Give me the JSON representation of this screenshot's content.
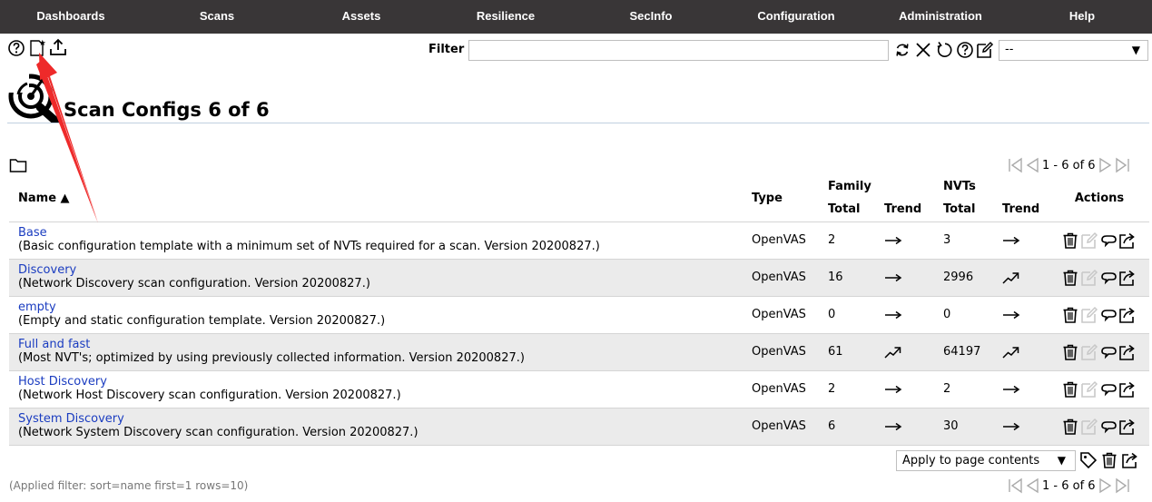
{
  "nav": {
    "items": [
      {
        "label": "Dashboards"
      },
      {
        "label": "Scans"
      },
      {
        "label": "Assets"
      },
      {
        "label": "Resilience"
      },
      {
        "label": "SecInfo"
      },
      {
        "label": "Configuration"
      },
      {
        "label": "Administration"
      },
      {
        "label": "Help"
      }
    ]
  },
  "toolbar": {
    "filter_label": "Filter",
    "filter_value": "",
    "filter_select_value": "--",
    "left_icons": [
      "help-icon",
      "new-scan-config-icon",
      "upload-icon"
    ],
    "right_icons": [
      "refresh-icon",
      "clear-icon",
      "reset-icon",
      "help-icon",
      "edit-filter-icon"
    ]
  },
  "title": {
    "text": "Scan Configs 6 of 6",
    "icon": "scan-config-icon"
  },
  "pagination": {
    "text": "1 - 6 of 6"
  },
  "table": {
    "headers": {
      "name": "Name ▲",
      "type": "Type",
      "family": "Family",
      "nvts": "NVTs",
      "actions": "Actions",
      "total": "Total",
      "trend": "Trend"
    },
    "rows": [
      {
        "name": "Base",
        "description": "(Basic configuration template with a minimum set of NVTs required for a scan. Version 20200827.)",
        "type": "OpenVAS",
        "family_total": "2",
        "family_trend": "flat",
        "nvts_total": "3",
        "nvts_trend": "flat"
      },
      {
        "name": "Discovery",
        "description": "(Network Discovery scan configuration. Version 20200827.)",
        "type": "OpenVAS",
        "family_total": "16",
        "family_trend": "flat",
        "nvts_total": "2996",
        "nvts_trend": "up"
      },
      {
        "name": "empty",
        "description": "(Empty and static configuration template. Version 20200827.)",
        "type": "OpenVAS",
        "family_total": "0",
        "family_trend": "flat",
        "nvts_total": "0",
        "nvts_trend": "flat"
      },
      {
        "name": "Full and fast",
        "description": "(Most NVT's; optimized by using previously collected information. Version 20200827.)",
        "type": "OpenVAS",
        "family_total": "61",
        "family_trend": "up",
        "nvts_total": "64197",
        "nvts_trend": "up"
      },
      {
        "name": "Host Discovery",
        "description": "(Network Host Discovery scan configuration. Version 20200827.)",
        "type": "OpenVAS",
        "family_total": "2",
        "family_trend": "flat",
        "nvts_total": "2",
        "nvts_trend": "flat"
      },
      {
        "name": "System Discovery",
        "description": "(Network System Discovery scan configuration. Version 20200827.)",
        "type": "OpenVAS",
        "family_total": "6",
        "family_trend": "flat",
        "nvts_total": "30",
        "nvts_trend": "flat"
      }
    ]
  },
  "footer": {
    "bulk_action": "Apply to page contents",
    "applied_filter": "(Applied filter: sort=name first=1 rows=10)"
  },
  "colors": {
    "nav_bg": "#393637",
    "link": "#1a3cc0",
    "row_alt": "#ebebeb",
    "annotation_arrow": "#ee2a2a"
  }
}
